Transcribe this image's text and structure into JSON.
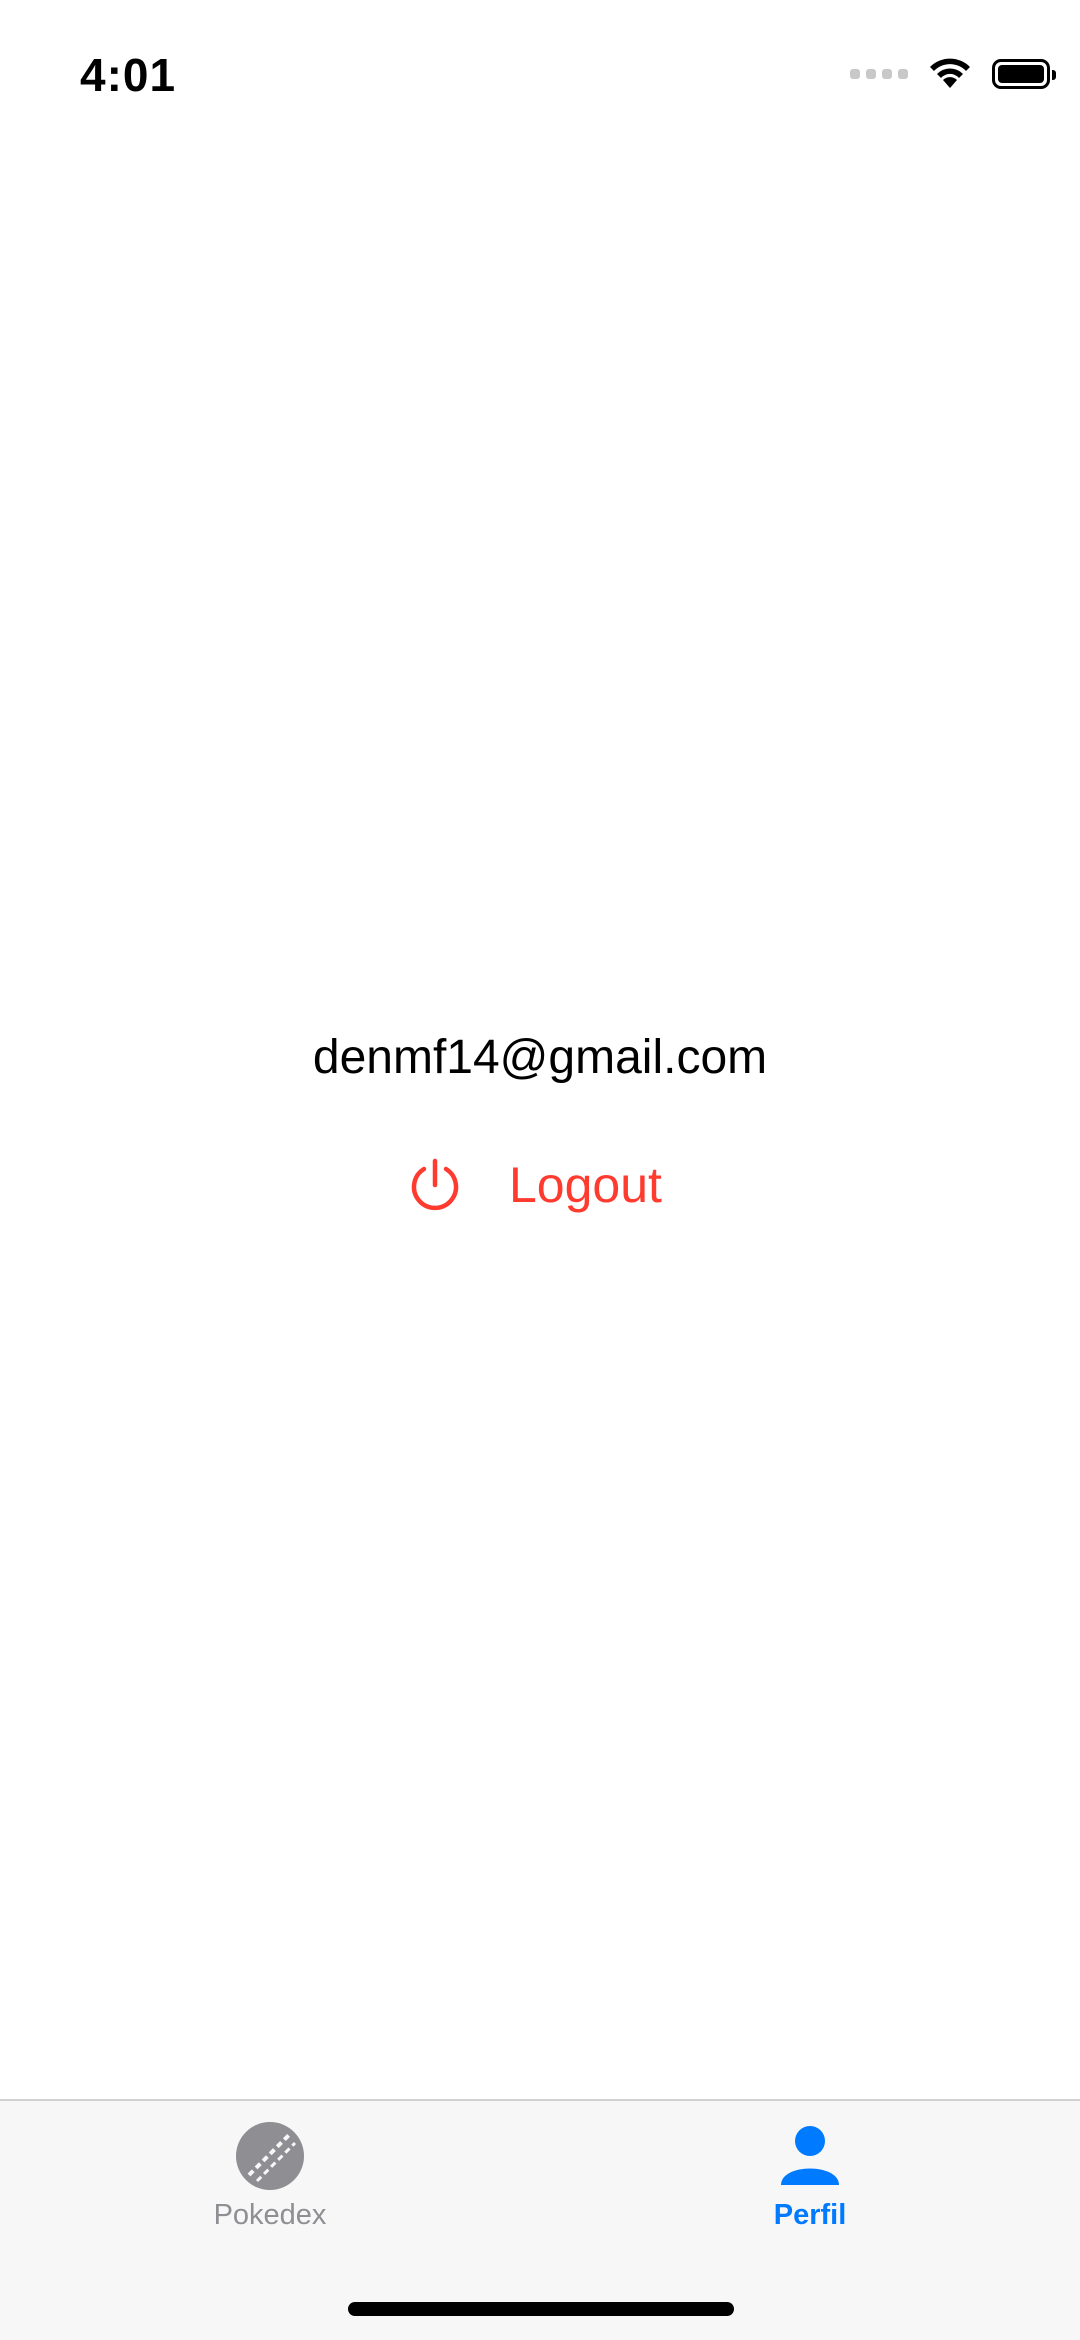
{
  "status_bar": {
    "time": "4:01"
  },
  "profile": {
    "email": "denmf14@gmail.com",
    "logout_label": "Logout",
    "logout_icon": "power-icon",
    "logout_color": "#ff3b30"
  },
  "tab_bar": {
    "tabs": [
      {
        "label": "Pokedex",
        "icon": "pokeball-icon",
        "active": false,
        "color": "#8e8e93"
      },
      {
        "label": "Perfil",
        "icon": "person-icon",
        "active": true,
        "color": "#007aff"
      }
    ]
  }
}
